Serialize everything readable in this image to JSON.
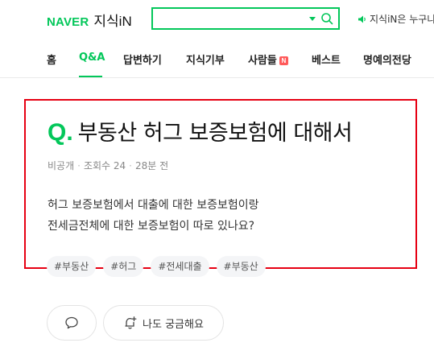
{
  "header": {
    "logo_naver": "NAVER",
    "logo_kin": "지식iN",
    "search": {
      "value": "",
      "placeholder": ""
    },
    "notice": "지식iN은 누구나"
  },
  "nav": {
    "tabs": [
      {
        "label": "홈",
        "active": false
      },
      {
        "label": "Q&A",
        "active": true
      },
      {
        "label": "답변하기",
        "active": false
      },
      {
        "label": "지식기부",
        "active": false
      },
      {
        "label": "사람들",
        "active": false,
        "badge": "N"
      },
      {
        "label": "베스트",
        "active": false
      },
      {
        "label": "명예의전당",
        "active": false
      }
    ]
  },
  "question": {
    "q_mark": "Q.",
    "title": "부동산 허그 보증보험에 대해서",
    "meta": {
      "author": "비공개",
      "views": "조회수 24",
      "time": "28분 전"
    },
    "content_lines": [
      "허그 보증보험에서 대출에 대한 보증보험이랑",
      "전세금전체에 대한 보증보험이 따로 있나요?"
    ],
    "tags": [
      "#부동산",
      "#허그",
      "#전세대출",
      "#부동산"
    ]
  },
  "actions": {
    "curious_label": "나도 궁금해요"
  },
  "colors": {
    "brand": "#03c75a",
    "highlight": "#e60012",
    "new_badge": "#ff5a5a"
  },
  "icons": {
    "search": "search-icon",
    "dropdown": "chevron-down-icon",
    "notice": "speaker-icon",
    "comment": "comment-icon",
    "curious": "bell-plus-icon"
  }
}
